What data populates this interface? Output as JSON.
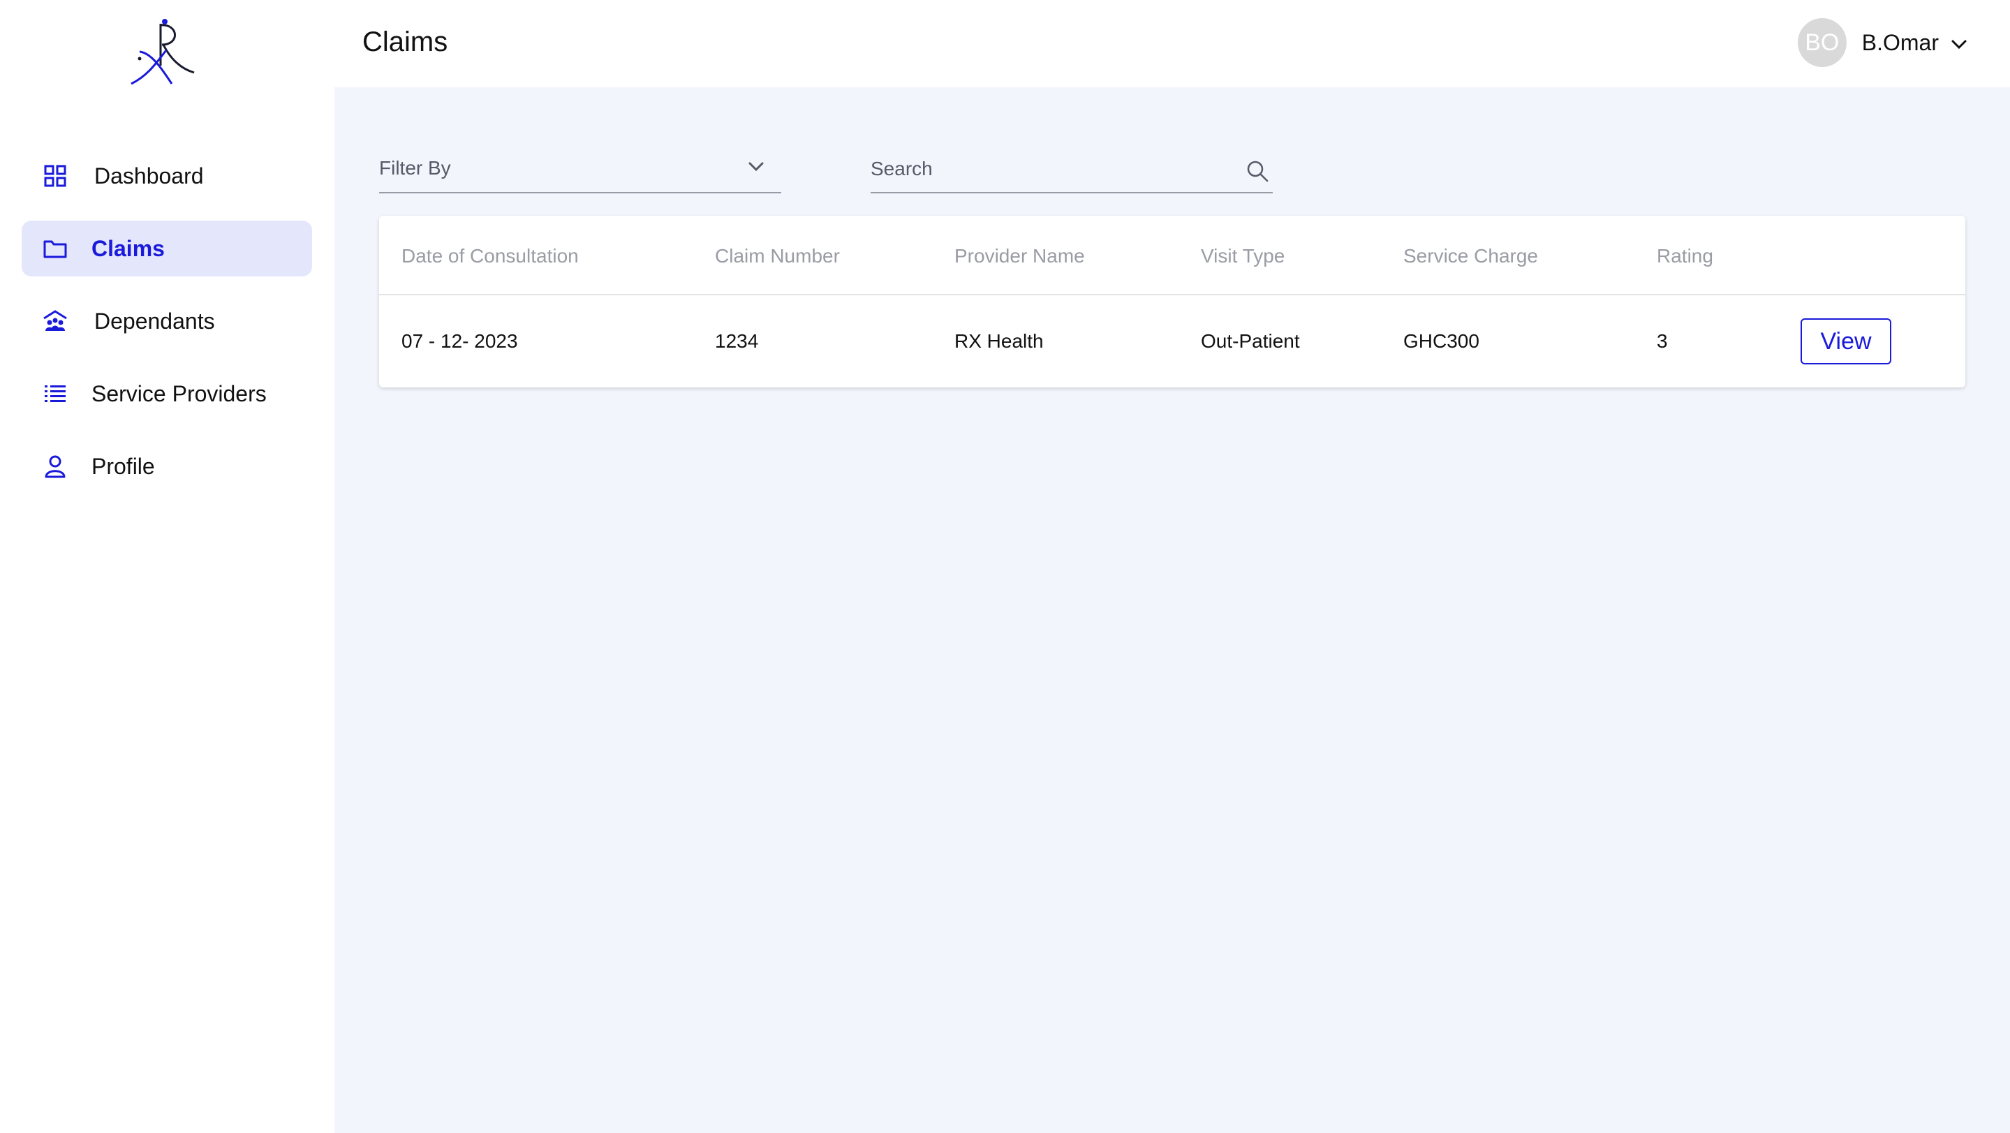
{
  "brand": {
    "logo_text": "xR",
    "accent_color": "#1a1adb"
  },
  "sidebar": {
    "items": [
      {
        "label": "Dashboard",
        "icon": "dashboard-grid-icon",
        "active": false
      },
      {
        "label": "Claims",
        "icon": "folder-icon",
        "active": true
      },
      {
        "label": "Dependants",
        "icon": "family-icon",
        "active": false
      },
      {
        "label": "Service Providers",
        "icon": "list-icon",
        "active": false
      },
      {
        "label": "Profile",
        "icon": "user-icon",
        "active": false
      }
    ]
  },
  "header": {
    "title": "Claims",
    "user": {
      "initials": "BO",
      "name": "B.Omar"
    }
  },
  "filters": {
    "filter_label": "Filter By",
    "search_placeholder": "Search"
  },
  "table": {
    "columns": [
      "Date of Consultation",
      "Claim Number",
      "Provider Name",
      "Visit Type",
      "Service Charge",
      "Rating"
    ],
    "rows": [
      {
        "date": "07 - 12- 2023",
        "claim_number": "1234",
        "provider": "RX Health",
        "visit_type": "Out-Patient",
        "service_charge": "GHC300",
        "rating": "3",
        "action_label": "View"
      }
    ]
  }
}
